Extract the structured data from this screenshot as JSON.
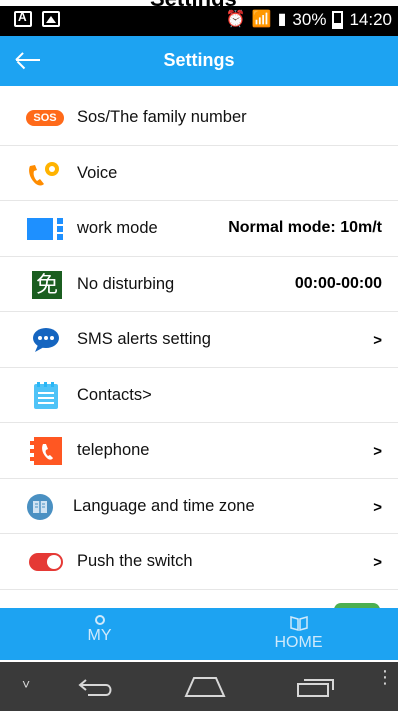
{
  "status_bar": {
    "battery": "30%",
    "time": "14:20"
  },
  "header": {
    "title": "Settings"
  },
  "settings": {
    "items": [
      {
        "label": "Sos/The family number",
        "value": "",
        "chev": ""
      },
      {
        "label": "Voice",
        "value": "",
        "chev": ""
      },
      {
        "label": "work mode",
        "value": "Normal mode: 10m/t",
        "chev": ""
      },
      {
        "label": "No disturbing",
        "value": "00:00-00:00",
        "chev": ""
      },
      {
        "label": "SMS alerts setting",
        "value": "",
        "chev": ">"
      },
      {
        "label": "Contacts>",
        "value": "",
        "chev": ""
      },
      {
        "label": "telephone",
        "value": "",
        "chev": ">"
      },
      {
        "label": "Language and time zone",
        "value": "",
        "chev": ">"
      },
      {
        "label": "Push the switch",
        "value": "",
        "chev": ">"
      }
    ],
    "icons": {
      "sos": "SOS",
      "no_disturbing": "免"
    }
  },
  "bottom_nav": {
    "my": "MY",
    "home": "HOME"
  }
}
